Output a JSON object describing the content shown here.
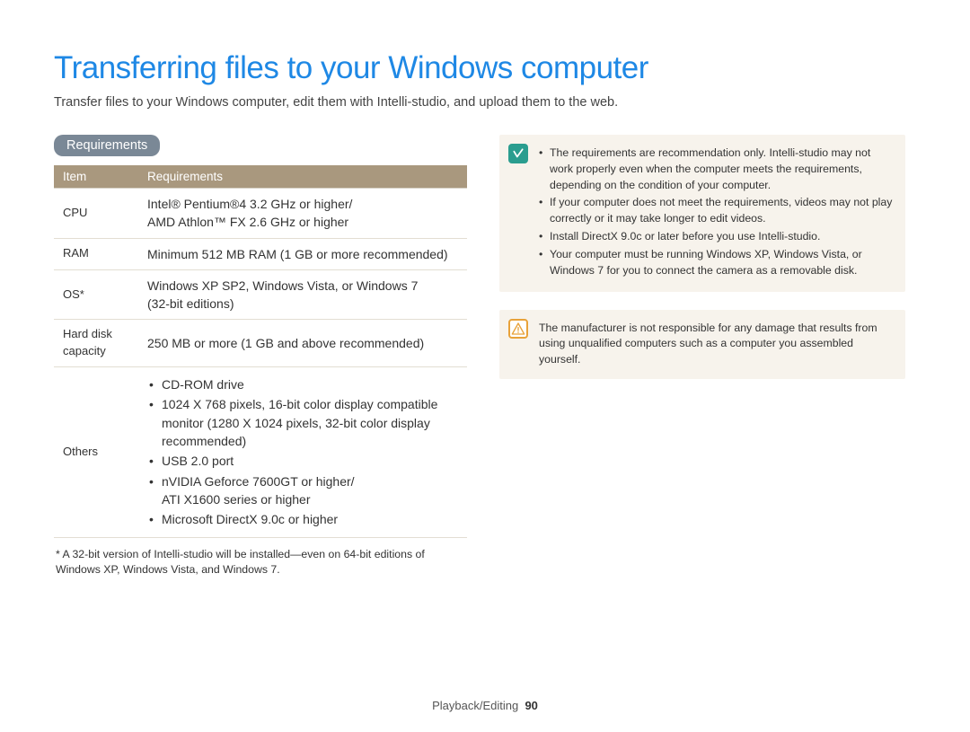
{
  "title": "Transferring files to your Windows computer",
  "intro": "Transfer files to your Windows computer, edit them with Intelli-studio, and upload them to the web.",
  "section_label": "Requirements",
  "table": {
    "headers": {
      "item": "Item",
      "req": "Requirements"
    },
    "rows": {
      "cpu": {
        "item": "CPU",
        "req": "Intel® Pentium®4 3.2 GHz or higher/\nAMD Athlon™ FX 2.6 GHz or higher"
      },
      "ram": {
        "item": "RAM",
        "req": "Minimum 512 MB RAM (1 GB or more recommended)"
      },
      "os": {
        "item": "OS*",
        "req": "Windows XP SP2, Windows Vista, or Windows 7\n(32-bit editions)"
      },
      "hdd": {
        "item": "Hard disk capacity",
        "req": "250 MB or more (1 GB and above recommended)"
      },
      "others_label": "Others",
      "others": [
        "CD-ROM drive",
        "1024 X 768 pixels, 16-bit color display compatible monitor (1280 X 1024 pixels, 32-bit color display recommended)",
        "USB 2.0 port",
        "nVIDIA Geforce 7600GT or higher/\nATI X1600 series or higher",
        "Microsoft DirectX 9.0c or higher"
      ]
    }
  },
  "footnote": "* A 32-bit version of Intelli-studio will be installed—even on 64-bit editions of Windows XP, Windows Vista, and Windows 7.",
  "info_notes": [
    "The requirements are recommendation only. Intelli-studio may not work properly even when the computer meets the requirements, depending on the condition of your computer.",
    "If your computer does not meet the requirements, videos may not play correctly or it may take longer to edit videos.",
    "Install DirectX 9.0c or later before you use Intelli-studio.",
    "Your computer must be running Windows XP, Windows Vista, or Windows 7 for you to connect the camera as a removable disk."
  ],
  "warning": "The manufacturer is not responsible for any damage that results from using unqualified computers such as a computer you assembled yourself.",
  "footer": {
    "section": "Playback/Editing",
    "page": "90"
  },
  "icons": {
    "info_glyph": "✓"
  }
}
